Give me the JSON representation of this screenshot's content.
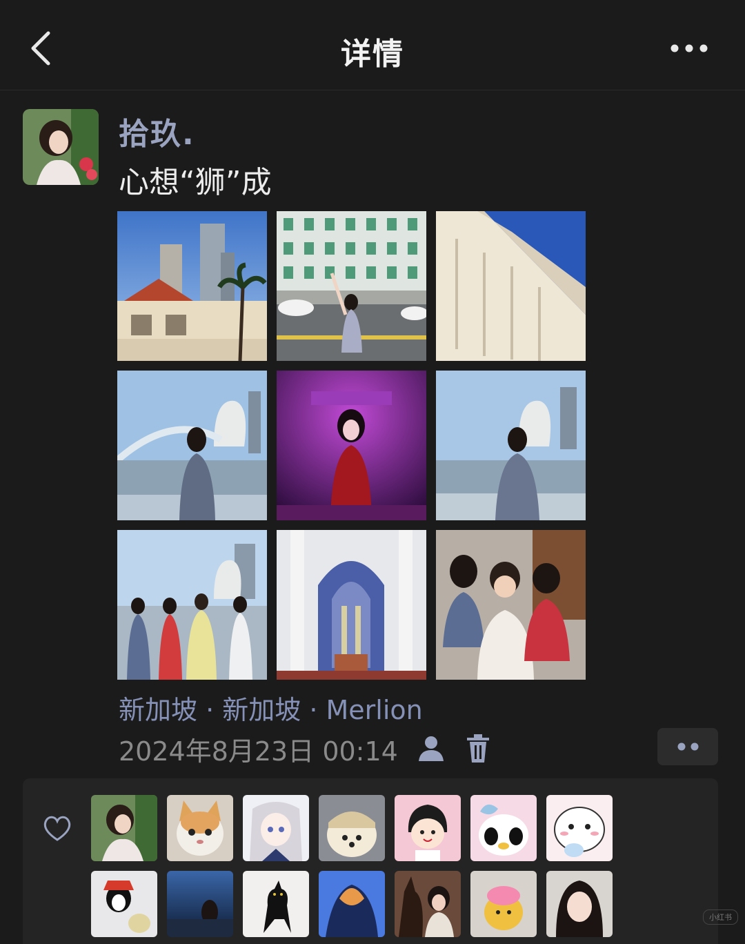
{
  "header": {
    "title": "详情",
    "back_icon": "chevron-left-icon",
    "more_icon": "more-horizontal-icon"
  },
  "post": {
    "username": "拾玖.",
    "text": "心想“狮”成",
    "location": "新加坡 · 新加坡 · Merlion",
    "timestamp": "2024年8月23日 00:14",
    "privacy_icon": "user-icon",
    "delete_icon": "trash-icon",
    "action_icon": "more-dots-icon"
  },
  "likes": {
    "icon": "heart-icon"
  },
  "watermark": "小红书"
}
